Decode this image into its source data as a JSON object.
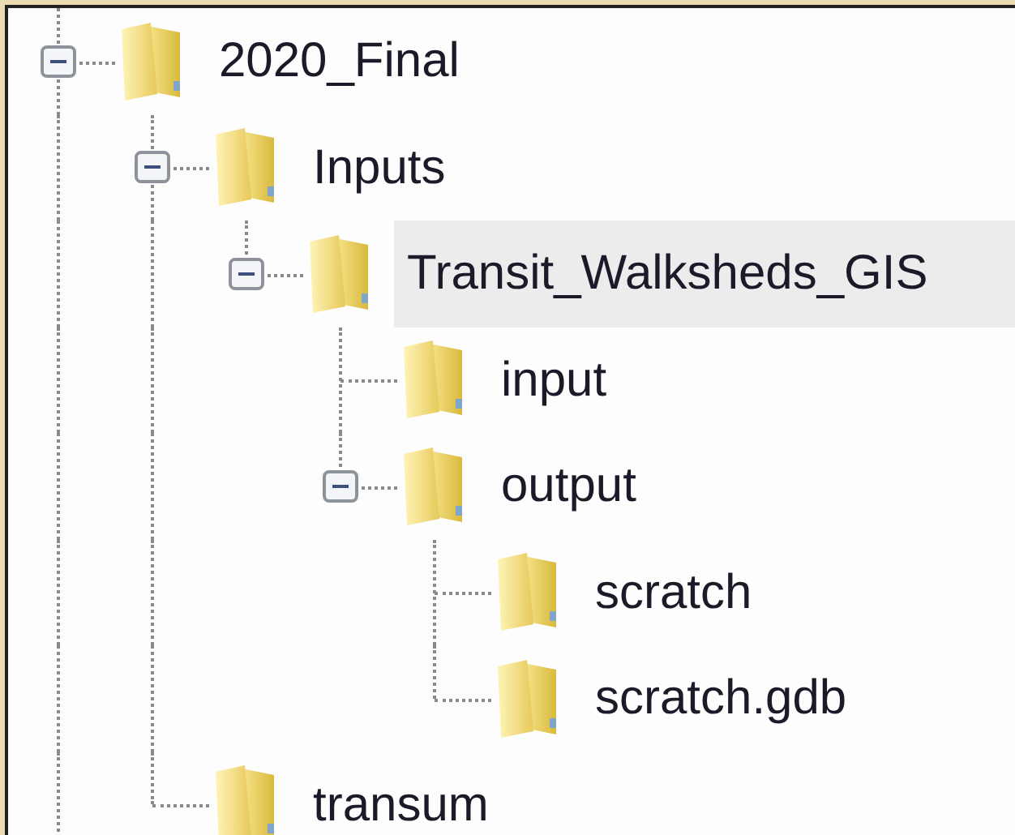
{
  "tree": [
    {
      "label": "2020_Final",
      "expanded": true,
      "selected": false,
      "children": [
        {
          "label": "Inputs",
          "expanded": true,
          "selected": false,
          "children": [
            {
              "label": "Transit_Walksheds_GIS",
              "expanded": true,
              "selected": true,
              "children": [
                {
                  "label": "input",
                  "selected": false
                },
                {
                  "label": "output",
                  "expanded": true,
                  "selected": false,
                  "children": [
                    {
                      "label": "scratch",
                      "selected": false
                    },
                    {
                      "label": "scratch.gdb",
                      "selected": false
                    }
                  ]
                }
              ]
            }
          ]
        },
        {
          "label": "transum",
          "selected": false
        }
      ]
    }
  ]
}
